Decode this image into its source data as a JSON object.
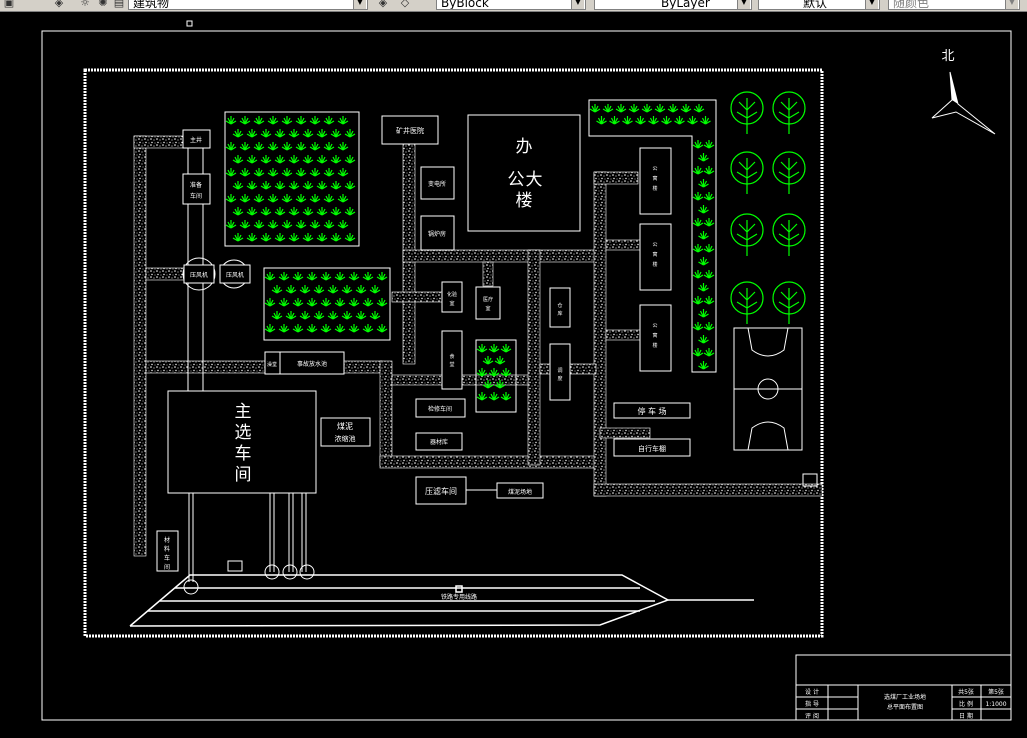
{
  "toolbar": {
    "layer_name": "建筑物",
    "color_value": "ByBlock",
    "linetype_value": "ByLayer",
    "lineweight_value": "默认",
    "plotstyle_value": "随颜色"
  },
  "icons": {
    "layer": "layer-stack-icon",
    "lightbulb": "lightbulb-icon",
    "dropdown": "chevron-down-icon"
  },
  "colors": {
    "background": "#000000",
    "line": "#ffffff",
    "vegetation": "#00ff00",
    "toolbar": "#d4d0c8"
  },
  "drawing": {
    "north_label": "北",
    "buildings": {
      "office": [
        "办",
        "公",
        "大",
        "楼"
      ],
      "main_workshop": [
        "主",
        "选",
        "车",
        "间"
      ],
      "mine_hospital": "矿井医院",
      "transformer": "变电所",
      "boiler": "锅炉房",
      "main_shaft": "主井",
      "aux_shaft": [
        "准备",
        "车间"
      ],
      "compressor_1": "压风机",
      "compressor_2": "压风机",
      "bath": "澡堂",
      "accident_pool": "事故放水池",
      "slime_thickener": [
        "煤泥",
        "浓缩池"
      ],
      "lab": [
        "化验",
        "室"
      ],
      "canteen": [
        "食",
        "堂"
      ],
      "inspection": "检修车间",
      "medical": [
        "医疗",
        "室"
      ],
      "storehouse": "器材库",
      "store2": [
        "仓",
        "库"
      ],
      "warehouse2": [
        "调",
        "度"
      ],
      "material_car": [
        "材",
        "料",
        "车",
        "间"
      ],
      "dorm_1": [
        "公",
        "寓",
        "楼"
      ],
      "dorm_2": [
        "公",
        "寓",
        "楼"
      ],
      "dorm_3": [
        "公",
        "寓",
        "楼"
      ],
      "parking": "停 车 场",
      "bike_shed": "自行车棚",
      "press_workshop": "压滤车间",
      "press_pool": "煤泥场地",
      "railway": "铁路专用线路"
    },
    "title_block": {
      "design": "设 计",
      "guide": "指 导",
      "review": "评 阅",
      "title1": "选煤厂工业场地",
      "title2": "总平面布置图",
      "sheets_total": "共5张",
      "sheet_no": "第5张",
      "scale_label": "比 例",
      "scale_value": "1:1000",
      "date_label": "日 期"
    }
  }
}
